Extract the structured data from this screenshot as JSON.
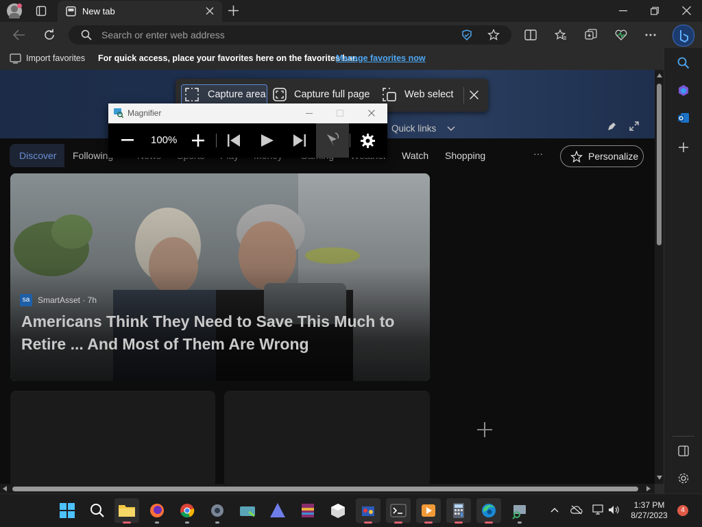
{
  "tab": {
    "title": "New tab"
  },
  "address": {
    "placeholder": "Search or enter web address"
  },
  "favorites_bar": {
    "import_label": "Import favorites",
    "message": "For quick access, place your favorites here on the favorites bar.",
    "link": "Manage favorites now"
  },
  "capture_toolbar": {
    "area": "Capture area",
    "full_page": "Capture full page",
    "web_select": "Web select"
  },
  "magnifier": {
    "title": "Magnifier",
    "zoom": "100%"
  },
  "feed": {
    "quick_links": "Quick links",
    "tabs": [
      "Discover",
      "Following",
      "News",
      "Sports",
      "Play",
      "Money",
      "Gaming",
      "Weather",
      "Watch",
      "Shopping"
    ],
    "more": "···",
    "personalize": "Personalize"
  },
  "card": {
    "source": "SmartAsset · 7h",
    "source_badge": "sa",
    "headline": "Americans Think They Need to Save This Much to Retire ... And Most of Them Are Wrong"
  },
  "taskbar": {
    "time": "1:37 PM",
    "date": "8/27/2023",
    "notifications": "4"
  },
  "colors": {
    "accent": "#4ea6f0",
    "personalize_border": "#8a8a8a",
    "notification_badge": "#e05a47"
  }
}
